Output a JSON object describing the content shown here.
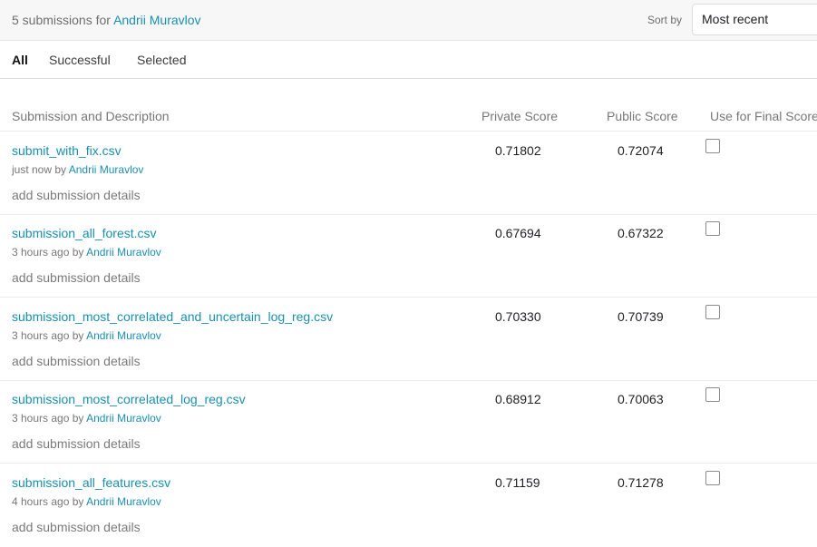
{
  "header": {
    "count_text": "5 submissions for",
    "user_name": "Andrii Muravlov",
    "sort_label": "Sort by",
    "sort_value": "Most recent"
  },
  "tabs": [
    {
      "label": "All",
      "active": true
    },
    {
      "label": "Successful",
      "active": false
    },
    {
      "label": "Selected",
      "active": false
    }
  ],
  "columns": {
    "submission": "Submission and Description",
    "private": "Private Score",
    "public": "Public Score",
    "final": "Use for Final Score"
  },
  "submissions": [
    {
      "file": "submit_with_fix.csv",
      "time": "just now",
      "by": "by",
      "user": "Andrii Muravlov",
      "details": "add submission details",
      "private_score": "0.71802",
      "public_score": "0.72074",
      "selected": false
    },
    {
      "file": "submission_all_forest.csv",
      "time": "3 hours ago",
      "by": "by",
      "user": "Andrii Muravlov",
      "details": "add submission details",
      "private_score": "0.67694",
      "public_score": "0.67322",
      "selected": false
    },
    {
      "file": "submission_most_correlated_and_uncertain_log_reg.csv",
      "time": "3 hours ago",
      "by": "by",
      "user": "Andrii Muravlov",
      "details": "add submission details",
      "private_score": "0.70330",
      "public_score": "0.70739",
      "selected": false
    },
    {
      "file": "submission_most_correlated_log_reg.csv",
      "time": "3 hours ago",
      "by": "by",
      "user": "Andrii Muravlov",
      "details": "add submission details",
      "private_score": "0.68912",
      "public_score": "0.70063",
      "selected": false
    },
    {
      "file": "submission_all_features.csv",
      "time": "4 hours ago",
      "by": "by",
      "user": "Andrii Muravlov",
      "details": "add submission details",
      "private_score": "0.71159",
      "public_score": "0.71278",
      "selected": false
    }
  ]
}
